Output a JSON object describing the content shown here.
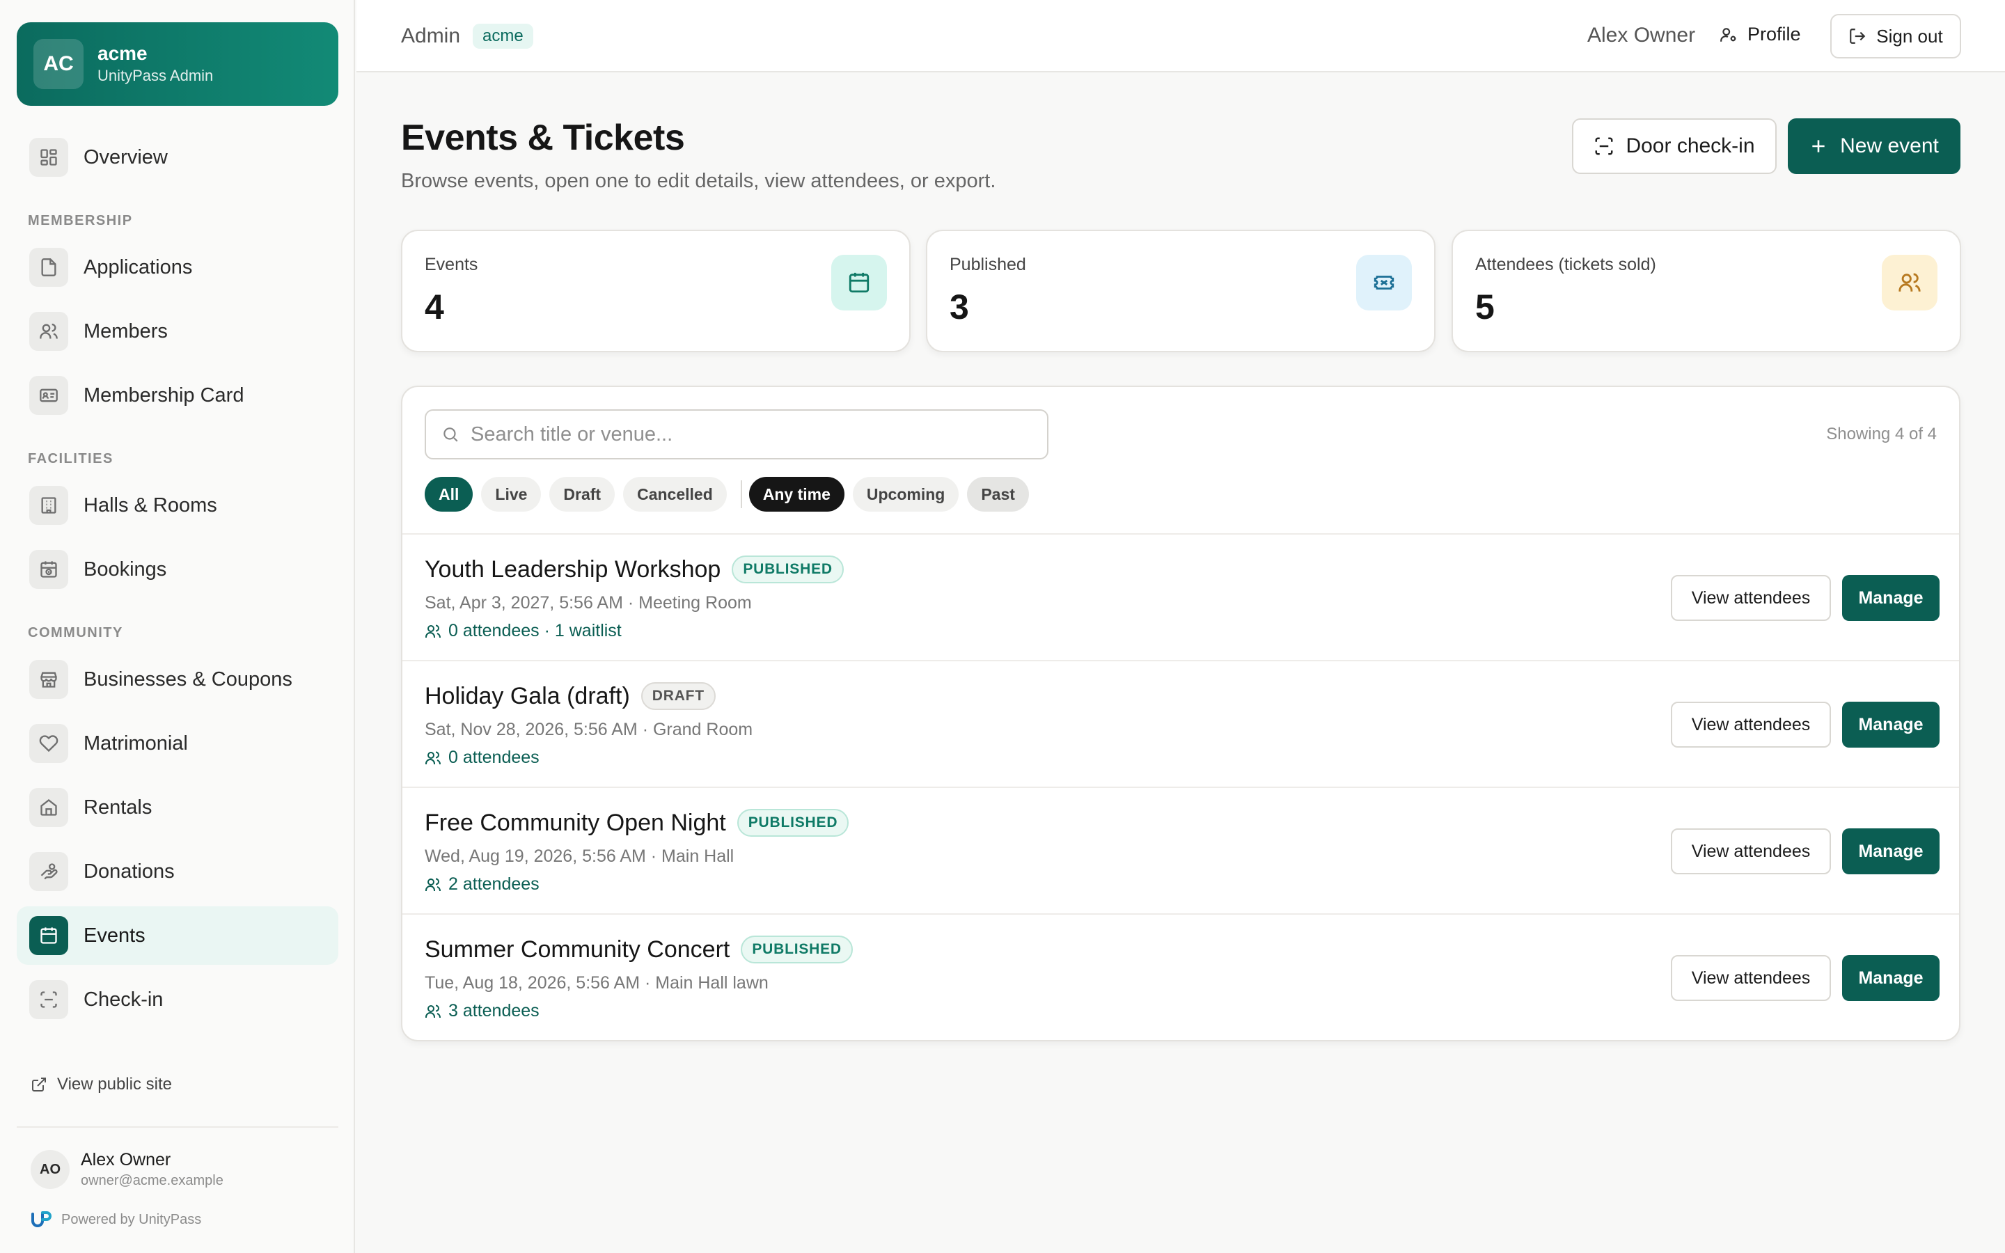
{
  "org": {
    "initials": "AC",
    "name": "acme",
    "subtitle": "UnityPass Admin"
  },
  "nav": {
    "overview": "Overview",
    "section_membership": "MEMBERSHIP",
    "applications": "Applications",
    "members": "Members",
    "membership_card": "Membership Card",
    "section_facilities": "FACILITIES",
    "halls_rooms": "Halls & Rooms",
    "bookings": "Bookings",
    "section_community": "COMMUNITY",
    "businesses_coupons": "Businesses & Coupons",
    "matrimonial": "Matrimonial",
    "rentals": "Rentals",
    "donations": "Donations",
    "events": "Events",
    "check_in": "Check-in",
    "active": "events"
  },
  "sidebar_footer": {
    "public_site": "View public site",
    "user_initials": "AO",
    "user_name": "Alex Owner",
    "user_email": "owner@acme.example",
    "powered_by": "Powered by UnityPass"
  },
  "topbar": {
    "breadcrumb": "Admin",
    "org_tag": "acme",
    "user_name": "Alex Owner",
    "profile": "Profile",
    "sign_out": "Sign out"
  },
  "header": {
    "title": "Events & Tickets",
    "subtitle": "Browse events, open one to edit details, view attendees, or export.",
    "door_checkin": "Door check-in",
    "new_event": "New event"
  },
  "stats": [
    {
      "label": "Events",
      "value": "4",
      "icon": "calendar-icon",
      "color": "#d6f5ee"
    },
    {
      "label": "Published",
      "value": "3",
      "icon": "ticket-icon",
      "color": "#e0f2fb"
    },
    {
      "label": "Attendees (tickets sold)",
      "value": "5",
      "icon": "users-icon",
      "color": "#fdf1d3"
    }
  ],
  "filters": {
    "search_placeholder": "Search title or venue...",
    "search_value": "",
    "showing": "Showing 4 of 4",
    "status_chips": [
      "All",
      "Live",
      "Draft",
      "Cancelled"
    ],
    "status_selected": "All",
    "time_chips": [
      "Any time",
      "Upcoming",
      "Past"
    ],
    "time_selected": "Any time"
  },
  "actions": {
    "view_attendees": "View attendees",
    "manage": "Manage"
  },
  "events": [
    {
      "title": "Youth Leadership Workshop",
      "status": "PUBLISHED",
      "meta": "Sat, Apr 3, 2027, 5:56 AM · Meeting Room",
      "attendees": "0 attendees · 1 waitlist"
    },
    {
      "title": "Holiday Gala (draft)",
      "status": "DRAFT",
      "meta": "Sat, Nov 28, 2026, 5:56 AM · Grand Room",
      "attendees": "0 attendees"
    },
    {
      "title": "Free Community Open Night",
      "status": "PUBLISHED",
      "meta": "Wed, Aug 19, 2026, 5:56 AM · Main Hall",
      "attendees": "2 attendees"
    },
    {
      "title": "Summer Community Concert",
      "status": "PUBLISHED",
      "meta": "Tue, Aug 18, 2026, 5:56 AM · Main Hall lawn",
      "attendees": "3 attendees"
    }
  ],
  "colors": {
    "brand": "#0b5e53",
    "brand_light": "#eaf6f3",
    "published": "#0f7a66"
  }
}
